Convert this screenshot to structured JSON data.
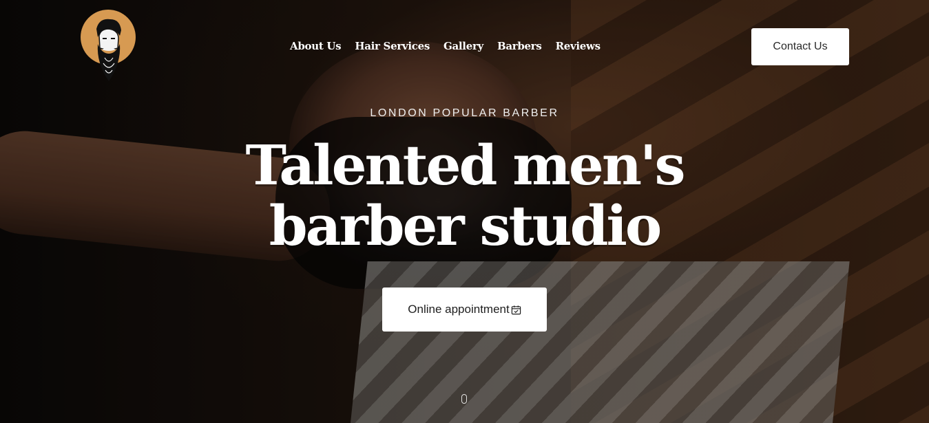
{
  "header": {
    "nav": [
      {
        "label": "About Us"
      },
      {
        "label": "Hair Services"
      },
      {
        "label": "Gallery"
      },
      {
        "label": "Barbers"
      },
      {
        "label": "Reviews"
      }
    ],
    "contact_label": "Contact Us",
    "logo_icon": "bearded-man-logo-icon"
  },
  "hero": {
    "eyebrow": "LONDON POPULAR BARBER",
    "headline_line1": "Talented men's",
    "headline_line2": "barber studio",
    "cta_label": "Online appointment",
    "cta_icon": "calendar-check-icon",
    "scroll_icon": "mouse-scroll-icon"
  },
  "colors": {
    "accent": "#d79a52",
    "button_bg": "#ffffff",
    "text_light": "#ffffff"
  }
}
